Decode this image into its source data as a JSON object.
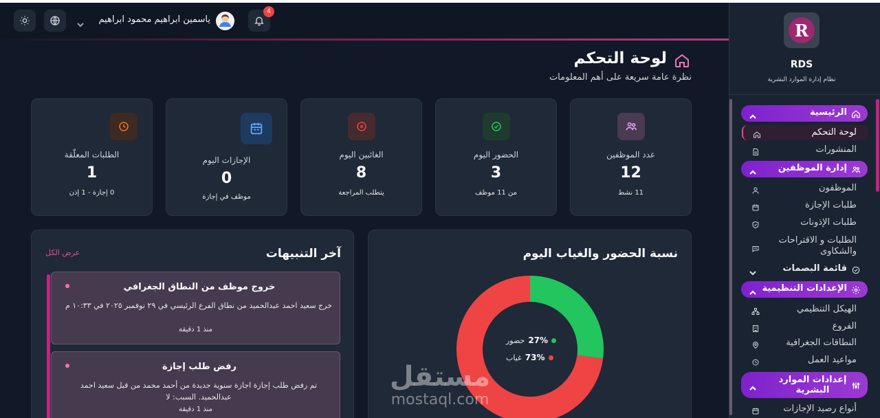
{
  "header": {
    "user_name": "ياسمين ابراهيم محمود ابراهيم",
    "notifications_count": "4",
    "icons": [
      "sun-icon",
      "globe-icon",
      "chevron-down-icon",
      "bell-icon"
    ]
  },
  "page": {
    "title": "لوحة التحكم",
    "subtitle": "نظرة عامة سريعة على أهم المعلومات"
  },
  "stats": [
    {
      "label": "عدد الموظفين",
      "value": "12",
      "note": "11 نشط",
      "icon": "users-icon",
      "color": "#e9a6ff"
    },
    {
      "label": "الحضور اليوم",
      "value": "3",
      "note": "من 11 موظف",
      "icon": "check-circle-icon",
      "color": "#22c55e"
    },
    {
      "label": "الغائبين اليوم",
      "value": "8",
      "note": "يتطلب المراجعة",
      "icon": "x-circle-icon",
      "color": "#ef4444"
    },
    {
      "label": "الإجازات اليوم",
      "value": "0",
      "note": "موظف في إجازة",
      "icon": "calendar-icon",
      "color": "#60a5fa"
    },
    {
      "label": "الطلبات المعلّقة",
      "value": "1",
      "note": "0 إجازة - 1 إذن",
      "icon": "clock-icon",
      "color": "#f97316"
    }
  ],
  "attendance": {
    "title": "نسبة الحضور والغياب اليوم"
  },
  "chart_data": {
    "type": "pie",
    "title": "نسبة الحضور والغياب اليوم",
    "categories": [
      "حضور",
      "غياب"
    ],
    "values": [
      27,
      73
    ],
    "value_labels": [
      "27%",
      "73%"
    ],
    "colors": [
      "#22c55e",
      "#ef4444"
    ],
    "legend": "center"
  },
  "notifications": {
    "title": "آخر التنبيهات",
    "view_all": "عرض الكل",
    "items": [
      {
        "title": "خروج موظف من النطاق الجغرافي",
        "body": "خرج سعيد احمد عبدالحميد من نطاق الفرع الرئيسي في ٢٩ نوفمبر ٢٠٢٥ في ١٠:٣٣ م",
        "time": "منذ 1 دقيقة"
      },
      {
        "title": "رفض طلب إجازة",
        "body": "تم رفض طلب إجازة اجازة سنوية جديدة من أحمد محمد من قبل سعيد احمد عبدالحميد. السبب: لا",
        "time": "منذ 1 دقيقة"
      }
    ]
  },
  "sidebar": {
    "brand": "RDS",
    "brand_sub": "نظام إدارة الموارد البشرية",
    "sections": [
      {
        "label": "الرئيسية",
        "icon": "home-icon",
        "items": [
          {
            "label": "لوحة التحكم",
            "icon": "home-icon"
          },
          {
            "label": "المنشورات",
            "icon": "document-icon"
          }
        ]
      },
      {
        "label": "إدارة الموظفين",
        "icon": "users-icon",
        "items": [
          {
            "label": "الموظفون",
            "icon": "user-icon"
          },
          {
            "label": "طلبات الإجازة",
            "icon": "calendar-icon"
          },
          {
            "label": "طلبات الإذونات",
            "icon": "shield-icon"
          },
          {
            "label": "الطلبات و الاقتراحات والشكاوى",
            "icon": "message-icon"
          }
        ]
      },
      {
        "label": "قائمة البصمات",
        "icon": "check-circle-icon",
        "items": []
      },
      {
        "label": "الإعدادات التنظيمية",
        "icon": "gear-icon",
        "items": [
          {
            "label": "الهيكل التنظيمي",
            "icon": "org-chart-icon"
          },
          {
            "label": "الفروع",
            "icon": "building-icon"
          },
          {
            "label": "النطاقات الجغرافية",
            "icon": "map-pin-icon"
          },
          {
            "label": "مواعيد العمل",
            "icon": "clock-icon"
          }
        ]
      },
      {
        "label": "إعدادات الموارد البشرية",
        "icon": "sliders-icon",
        "items": [
          {
            "label": "أنواع رصيد الإجازات",
            "icon": "calendar-icon"
          }
        ]
      }
    ]
  },
  "watermark": {
    "ar": "مستقل",
    "en": "mostaql.com"
  }
}
